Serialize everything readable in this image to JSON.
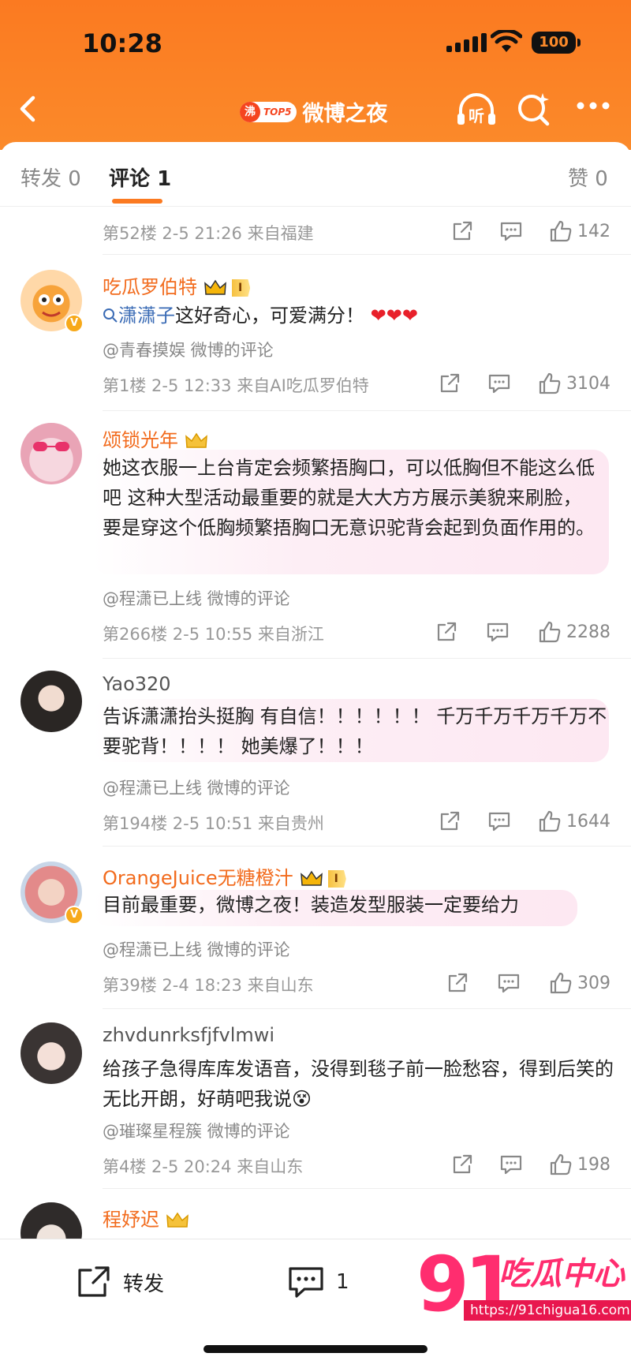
{
  "status": {
    "time": "10:28",
    "battery": "100"
  },
  "nav": {
    "topic_fei": "沸",
    "topic_rank": "TOP5",
    "title": "微博之夜"
  },
  "tabs": {
    "repost": "转发 0",
    "comments_label": "评论",
    "comments_count": "1",
    "likes": "赞 0"
  },
  "comments": [
    {
      "meta": "第52楼  2-5 21:26  来自福建",
      "likes": "142"
    },
    {
      "name": "吃瓜罗伯特",
      "level": "I",
      "text_link": "潇潇子",
      "text": "这好奇心，可爱满分！",
      "source": "@青春摸娱  微博的评论",
      "meta": "第1楼  2-5 12:33  来自AI吃瓜罗伯特",
      "likes": "3104"
    },
    {
      "name": "颂锁光年",
      "text": "她这衣服一上台肯定会频繁捂胸口，可以低胸但不能这么低吧 这种大型活动最重要的就是大大方方展示美貌来刷脸，要是穿这个低胸频繁捂胸口无意识驼背会起到负面作用的。",
      "source": "@程潇已上线  微博的评论",
      "meta": "第266楼  2-5 10:55  来自浙江",
      "likes": "2288"
    },
    {
      "name": "Yao320",
      "text": "告诉潇潇抬头挺胸 有自信！！！！！！ 千万千万千万千万不要驼背！！！！ 她美爆了！！！",
      "source": "@程潇已上线  微博的评论",
      "meta": "第194楼  2-5 10:51  来自贵州",
      "likes": "1644"
    },
    {
      "name": "OrangeJuice无糖橙汁",
      "level": "I",
      "text": "目前最重要，微博之夜！装造发型服装一定要给力",
      "source": "@程潇已上线  微博的评论",
      "meta": "第39楼  2-4 18:23  来自山东",
      "likes": "309"
    },
    {
      "name": "zhvdunrksfjfvlmwi",
      "text": "给孩子急得库库发语音，没得到毯子前一脸愁容，得到后笑的无比开朗，好萌吧我说",
      "source": "@璀璨星程簇  微博的评论",
      "meta": "第4楼  2-5 20:24  来自山东",
      "likes": "198"
    },
    {
      "name": "程妤迟"
    }
  ],
  "bottom": {
    "repost_label": "转发",
    "comment_count": "1"
  },
  "watermark": {
    "number": "91",
    "brand": "吃瓜中心",
    "url": "https://91chigua16.com"
  },
  "colors": {
    "header": "#fb7a21",
    "name_orange": "#f26b1d",
    "link": "#3a6bb5",
    "watermark": "#ff2d6f"
  }
}
